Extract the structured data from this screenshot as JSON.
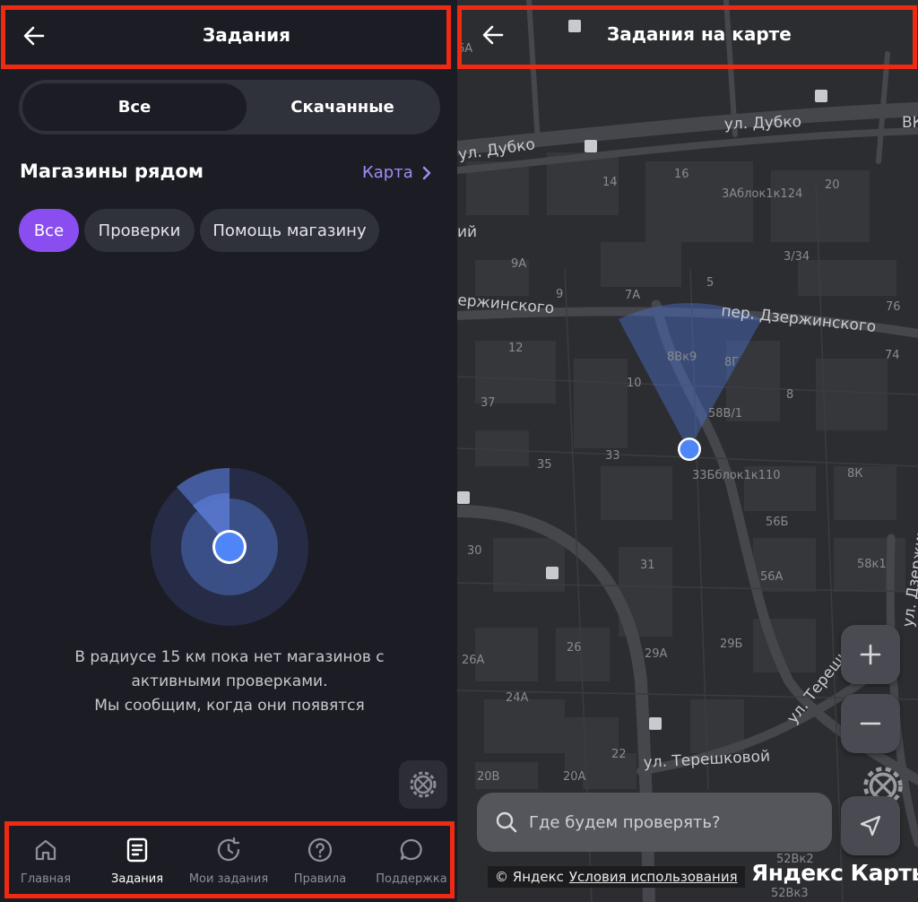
{
  "left": {
    "header": {
      "title": "Задания"
    },
    "segments": {
      "all": "Все",
      "downloaded": "Скачанные"
    },
    "section_title": "Магазины рядом",
    "map_link": "Карта",
    "chips": {
      "all": "Все",
      "checks": "Проверки",
      "help": "Помощь магазину"
    },
    "empty": {
      "line1": "В радиусе 15 км пока нет магазинов с",
      "line2": "активными проверками.",
      "line3": "Мы сообщим, когда они появятся"
    },
    "tabs": [
      {
        "label": "Главная",
        "icon": "home-icon"
      },
      {
        "label": "Задания",
        "icon": "document-icon"
      },
      {
        "label": "Мои задания",
        "icon": "history-clock-icon"
      },
      {
        "label": "Правила",
        "icon": "question-icon"
      },
      {
        "label": "Поддержка",
        "icon": "chat-bubble-icon"
      }
    ]
  },
  "right": {
    "header": {
      "title": "Задания на карте"
    },
    "search_placeholder": "Где будем проверять?",
    "attribution": {
      "copyright": "© Яндекс",
      "terms": "Условия использования"
    },
    "logo": "Яндекс Карты",
    "streets": [
      "ул. Дубко",
      "ул. Дубко",
      "пер. Дзержинского",
      "ержинского",
      "ул. Терешковой",
      "ул. Терешкова",
      "ул. Дзержинского",
      "ий",
      "ВК"
    ],
    "house_numbers": [
      "16",
      "14",
      "3Аблок1к124",
      "20",
      "3/34",
      "9А",
      "9",
      "5",
      "7А",
      "76",
      "12",
      "8Вк9",
      "8Г",
      "74",
      "10",
      "8",
      "37",
      "58В/1",
      "33",
      "35",
      "33Бблок1к110",
      "8К",
      "56Б",
      "30",
      "31",
      "58к1",
      "56А",
      "26",
      "26А",
      "29А",
      "29Б",
      "24А",
      "22",
      "20В",
      "20А",
      "52Вк2",
      "52Вк3",
      "6А"
    ]
  }
}
